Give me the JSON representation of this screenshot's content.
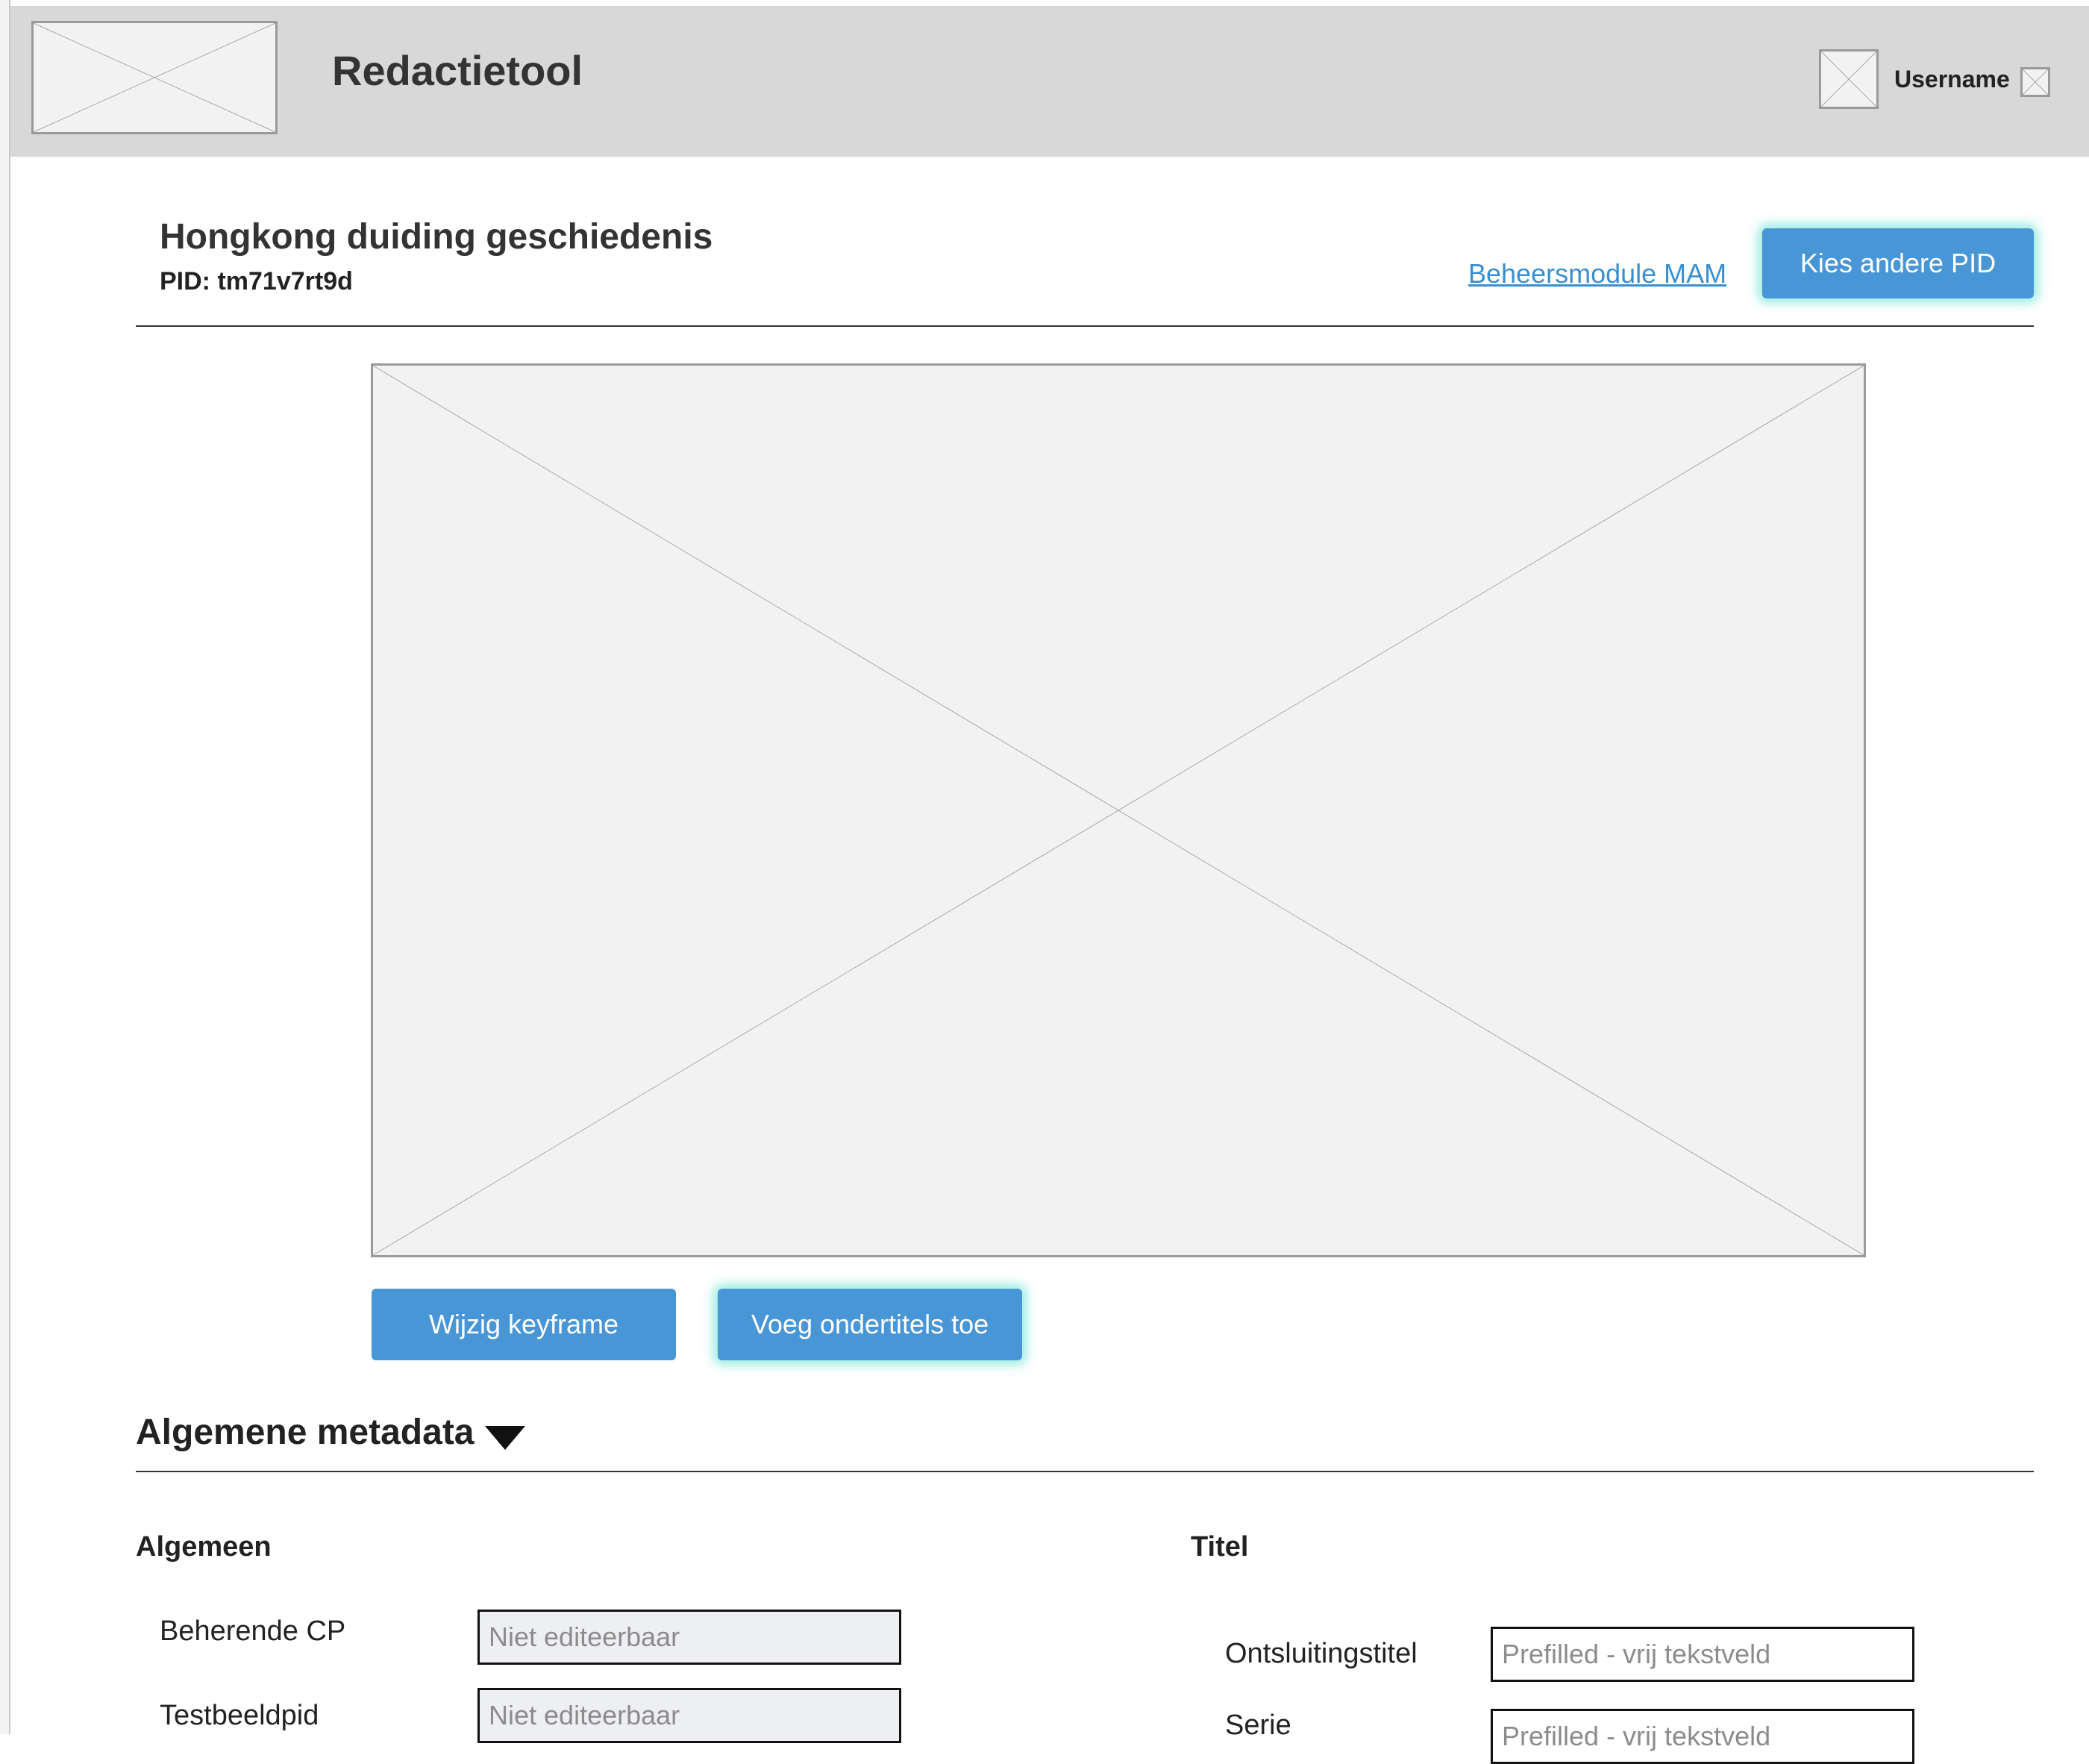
{
  "header": {
    "app_title": "Redactietool",
    "username": "Username",
    "logo_icon": "image-placeholder-icon",
    "avatar_icon": "image-placeholder-icon",
    "menu_icon": "image-placeholder-icon"
  },
  "page": {
    "title": "Hongkong duiding geschiedenis",
    "pid": "PID: tm71v7rt9d",
    "mam_link": "Beheersmodule MAM",
    "change_pid_button": "Kies andere PID"
  },
  "media": {
    "keyframe_icon": "image-placeholder-icon",
    "edit_keyframe_button": "Wijzig keyframe",
    "add_subtitles_button": "Voeg ondertitels toe"
  },
  "metadata": {
    "section_title": "Algemene metadata",
    "toggle_icon": "triangle-down-icon",
    "general": {
      "title": "Algemeen",
      "fields": [
        {
          "label": "Beherende CP",
          "placeholder": "Niet editeerbaar"
        },
        {
          "label": "Testbeeldpid",
          "placeholder": "Niet editeerbaar"
        }
      ]
    },
    "title_group": {
      "title": "Titel",
      "fields": [
        {
          "label": "Ontsluitingstitel",
          "placeholder": "Prefilled - vrij tekstveld"
        },
        {
          "label": "Serie",
          "placeholder": "Prefilled - vrij tekstveld"
        }
      ]
    }
  },
  "colors": {
    "primary_button": "#4896d5",
    "button_glow": "#46dcc8",
    "link": "#3a8fd0",
    "header_bg": "#d8d8d8"
  }
}
